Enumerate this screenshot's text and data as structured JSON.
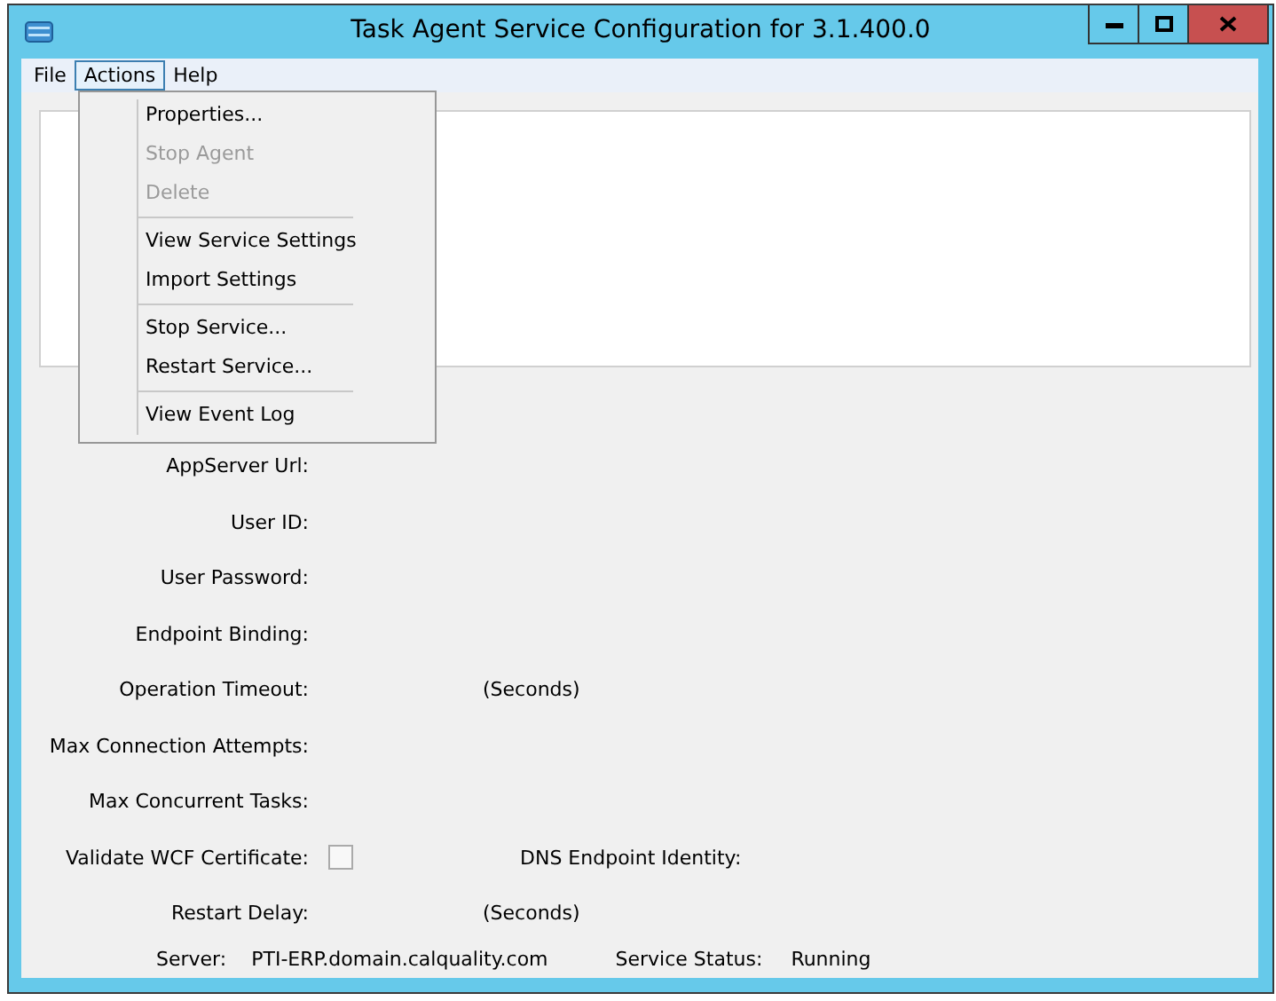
{
  "window": {
    "title": "Task Agent Service Configuration for 3.1.400.0"
  },
  "menu_bar": [
    {
      "label": "File",
      "selected": false
    },
    {
      "label": "Actions",
      "selected": true
    },
    {
      "label": "Help",
      "selected": false
    }
  ],
  "actions_menu": {
    "groups": [
      [
        {
          "label": "Properties...",
          "disabled": false
        },
        {
          "label": "Stop Agent",
          "disabled": true
        },
        {
          "label": "Delete",
          "disabled": true
        }
      ],
      [
        {
          "label": "View Service Settings",
          "disabled": false
        },
        {
          "label": "Import Settings",
          "disabled": false
        }
      ],
      [
        {
          "label": "Stop Service...",
          "disabled": false
        },
        {
          "label": "Restart Service...",
          "disabled": false
        }
      ],
      [
        {
          "label": "View Event Log",
          "disabled": false
        }
      ]
    ]
  },
  "settings": [
    {
      "kind": "plain",
      "label": "AppServer Url:"
    },
    {
      "kind": "plain",
      "label": "User ID:"
    },
    {
      "kind": "plain",
      "label": "User Password:"
    },
    {
      "kind": "plain",
      "label": "Endpoint Binding:"
    },
    {
      "kind": "unit",
      "label": "Operation Timeout:",
      "unit": "(Seconds)"
    },
    {
      "kind": "plain",
      "label": "Max Connection Attempts:"
    },
    {
      "kind": "plain",
      "label": "Max Concurrent Tasks:"
    },
    {
      "kind": "checkbox",
      "label": "Validate WCF Certificate:",
      "checked": false,
      "side_label": "DNS Endpoint Identity:"
    },
    {
      "kind": "unit",
      "label": "Restart Delay:",
      "unit": "(Seconds)"
    }
  ],
  "status": {
    "server_label": "Server:",
    "server": "PTI-ERP.domain.calquality.com",
    "status_label": "Service Status:",
    "status": "Running"
  }
}
